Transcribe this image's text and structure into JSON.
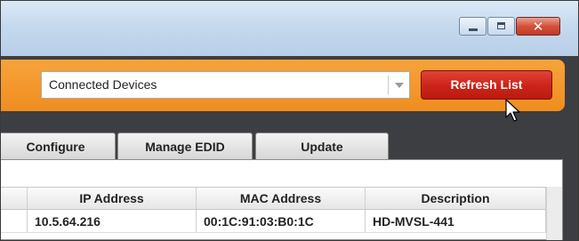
{
  "window": {
    "controls": {
      "minimize": "minimize-icon",
      "maximize": "maximize-icon",
      "close": "close-icon"
    }
  },
  "toolbar": {
    "device_filter": {
      "selected": "Connected Devices",
      "options": [
        "Connected Devices"
      ]
    },
    "refresh_label": "Refresh List"
  },
  "tabs": [
    {
      "label": "Configure"
    },
    {
      "label": "Manage EDID"
    },
    {
      "label": "Update"
    }
  ],
  "table": {
    "columns": [
      "IP Address",
      "MAC Address",
      "Description"
    ],
    "rows": [
      {
        "ip": "10.5.64.216",
        "mac": "00:1C:91:03:B0:1C",
        "description": "HD-MVSL-441"
      }
    ]
  },
  "colors": {
    "toolbar_orange": "#f08d1f",
    "refresh_red": "#cc2318",
    "dark_background": "#3d3e41"
  }
}
